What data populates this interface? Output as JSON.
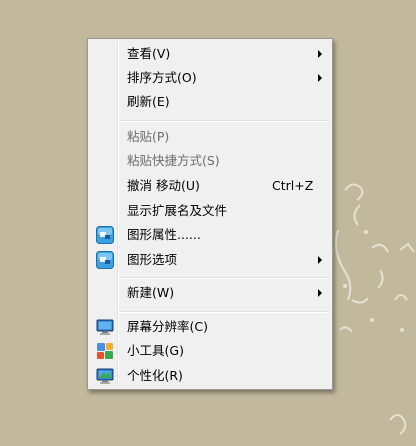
{
  "context_menu": {
    "items": [
      {
        "label": "查看(V)",
        "submenu": true
      },
      {
        "label": "排序方式(O)",
        "submenu": true
      },
      {
        "label": "刷新(E)"
      },
      {
        "label": "粘贴(P)",
        "disabled": true
      },
      {
        "label": "粘贴快捷方式(S)",
        "disabled": true
      },
      {
        "label": "撤消 移动(U)",
        "shortcut": "Ctrl+Z"
      },
      {
        "label": "显示扩展名及文件"
      },
      {
        "label": "图形属性......",
        "icon": "graphics-properties-icon"
      },
      {
        "label": "图形选项",
        "icon": "graphics-options-icon",
        "submenu": true
      },
      {
        "label": "新建(W)",
        "submenu": true
      },
      {
        "label": "屏幕分辨率(C)",
        "icon": "screen-resolution-icon"
      },
      {
        "label": "小工具(G)",
        "icon": "gadgets-icon"
      },
      {
        "label": "个性化(R)",
        "icon": "personalize-icon"
      }
    ]
  },
  "colors": {
    "desktop_background": "#c2b89b",
    "menu_background": "#f0f0f0",
    "disabled_text": "#6d6d6d"
  }
}
